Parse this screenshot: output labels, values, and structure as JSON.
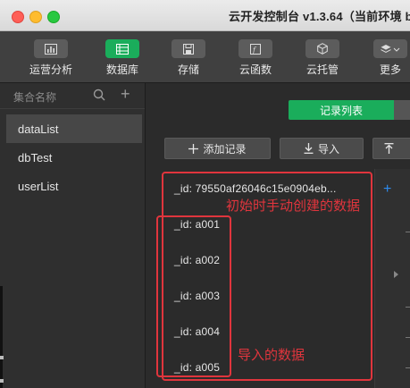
{
  "window": {
    "title": "云开发控制台 v1.3.64（当前环境 b"
  },
  "toolbar": {
    "items": [
      {
        "label": "运营分析",
        "icon": "chart-icon"
      },
      {
        "label": "数据库",
        "icon": "database-icon"
      },
      {
        "label": "存储",
        "icon": "storage-icon"
      },
      {
        "label": "云函数",
        "icon": "function-icon"
      },
      {
        "label": "云托管",
        "icon": "cube-icon"
      },
      {
        "label": "更多",
        "icon": "layers-icon"
      }
    ],
    "active_color": "#1aad5b"
  },
  "sidebar": {
    "title": "集合名称",
    "collections": [
      "dataList",
      "dbTest",
      "userList"
    ]
  },
  "main": {
    "tab_label": "记录列表",
    "add_record_label": "添加记录",
    "import_label": "导入",
    "records": [
      "_id: 79550af26046c15e0904eb...",
      "_id: a001",
      "_id: a002",
      "_id: a003",
      "_id: a004",
      "_id: a005"
    ],
    "detail_add": "+"
  },
  "annotations": {
    "manual_label": "初始时手动创建的数据",
    "import_label": "导入的数据",
    "color": "#e0353d"
  }
}
